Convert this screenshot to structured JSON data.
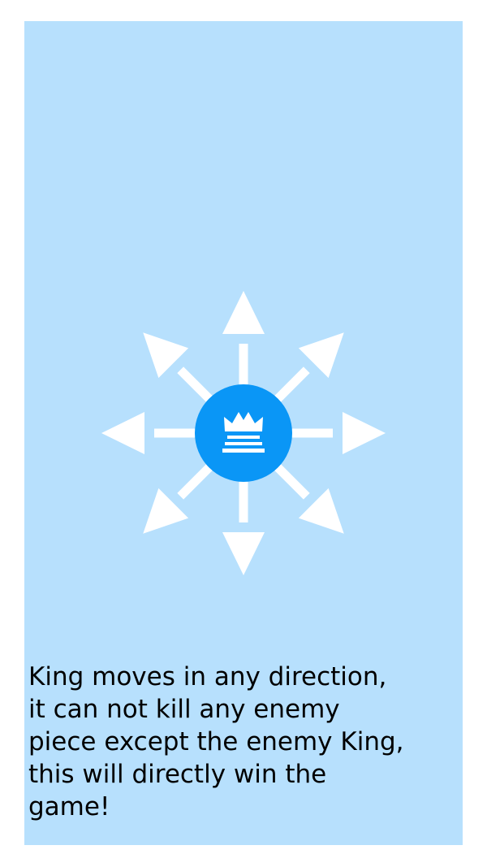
{
  "tutorial": {
    "piece": "king",
    "piece_icon": "crown-icon",
    "piece_color": "#0a96f6",
    "panel_color": "#b7e0fd",
    "arrow_color": "#ffffff",
    "move_directions": [
      "up",
      "up-right",
      "right",
      "down-right",
      "down",
      "down-left",
      "left",
      "up-left"
    ],
    "description": "King moves in any direction,\nit can not kill any enemy\npiece except the enemy King,\nthis will directly win the\ngame!"
  }
}
